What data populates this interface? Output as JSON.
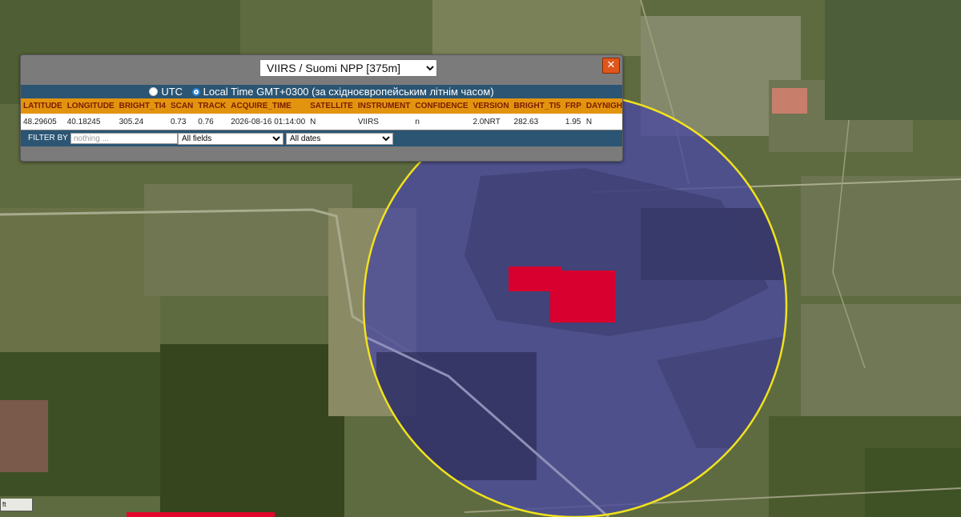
{
  "popup": {
    "sensor_selected": "VIIRS / Suomi NPP [375m]",
    "close_symbol": "✕",
    "time_options": {
      "utc_label": "UTC",
      "local_label": "Local Time GMT+0300 (за східноєвропейським літнім часом)",
      "selected": "local"
    },
    "table": {
      "headers": [
        "LATITUDE",
        "LONGITUDE",
        "BRIGHT_TI4",
        "SCAN",
        "TRACK",
        "ACQUIRE_TIME",
        "SATELLITE",
        "INSTRUMENT",
        "CONFIDENCE",
        "VERSION",
        "BRIGHT_TI5",
        "FRP",
        "DAYNIGHT"
      ],
      "rows": [
        [
          "48.29605",
          "40.18245",
          "305.24",
          "0.73",
          "0.76",
          "2026-08-16 01:14:00",
          "N",
          "VIIRS",
          "n",
          "2.0NRT",
          "282.63",
          "1.95",
          "N"
        ]
      ]
    },
    "filter": {
      "label": "FILTER BY",
      "placeholder": "nothing ...",
      "field_selected": "All fields",
      "date_selected": "All dates"
    }
  },
  "scale": {
    "label": "ft"
  },
  "colors": {
    "table_header_bg": "#e3940f",
    "table_header_text": "#7a1b00",
    "bar_blue": "#2b5573",
    "close_orange": "#e0561b",
    "circle_outline": "#f1e21e",
    "fire_red": "#d8002e",
    "overlay_purple": "#4a4a9e"
  }
}
